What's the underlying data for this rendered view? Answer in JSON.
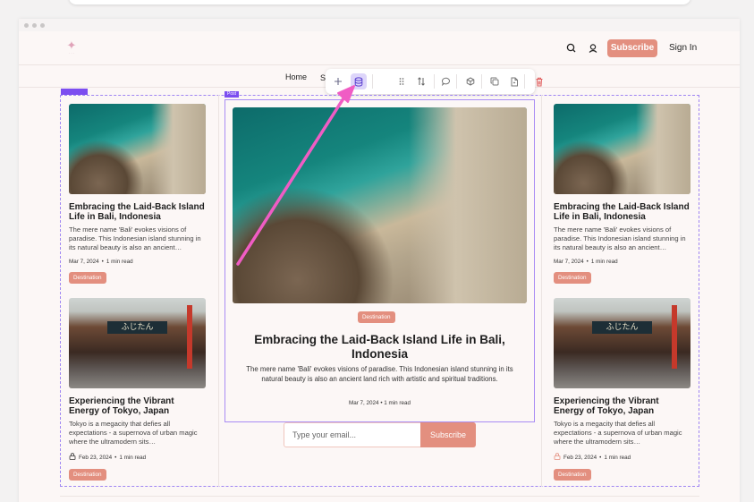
{
  "header": {
    "subscribe_label": "Subscribe",
    "signin_label": "Sign In"
  },
  "nav": {
    "home": "Home",
    "second_partial": "S"
  },
  "selection": {
    "post_tag": "Post"
  },
  "colors": {
    "accent": "#e38f7f",
    "selection": "#7c4ef0",
    "arrow": "#f05cc4"
  },
  "toolbar_icons": [
    "plus-icon",
    "database-icon",
    "drag-handle-icon",
    "sort-icon",
    "comment-icon",
    "cube-icon",
    "duplicate-icon",
    "file-icon",
    "trash-icon"
  ],
  "left_cards": [
    {
      "title": "Embracing the Laid-Back Island Life in Bali, Indonesia",
      "excerpt": "The mere name 'Bali' evokes visions of paradise. This Indonesian island stunning in its natural beauty is also an ancient…",
      "date": "Mar 7, 2024",
      "read_time": "1 min read",
      "tag": "Destination"
    },
    {
      "title": "Experiencing the Vibrant Energy of Tokyo, Japan",
      "excerpt": "Tokyo is a megacity that defies all expectations - a supernova of urban magic where the ultramodern sits…",
      "date": "Feb 23, 2024",
      "read_time": "1 min read",
      "tag": "Destination"
    }
  ],
  "right_cards": [
    {
      "title": "Embracing the Laid-Back Island Life in Bali, Indonesia",
      "excerpt": "The mere name 'Bali' evokes visions of paradise. This Indonesian island stunning in its natural beauty is also an ancient…",
      "date": "Mar 7, 2024",
      "read_time": "1 min read",
      "tag": "Destination"
    },
    {
      "title": "Experiencing the Vibrant Energy of Tokyo, Japan",
      "excerpt": "Tokyo is a megacity that defies all expectations - a supernova of urban magic where the ultramodern sits…",
      "date": "Feb 23, 2024",
      "read_time": "1 min read",
      "tag": "Destination"
    }
  ],
  "featured": {
    "tag": "Destination",
    "title": "Embracing the Laid-Back Island Life in Bali, Indonesia",
    "excerpt": "The mere name 'Bali' evokes visions of paradise. This Indonesian island stunning in its natural beauty is also an ancient land rich with artistic and spiritual traditions.",
    "date": "Mar 7, 2024",
    "read_time": "1 min read"
  },
  "tokyo_sign_text": "ふじたん",
  "newsletter": {
    "placeholder": "Type your email...",
    "button_label": "Subscribe"
  }
}
